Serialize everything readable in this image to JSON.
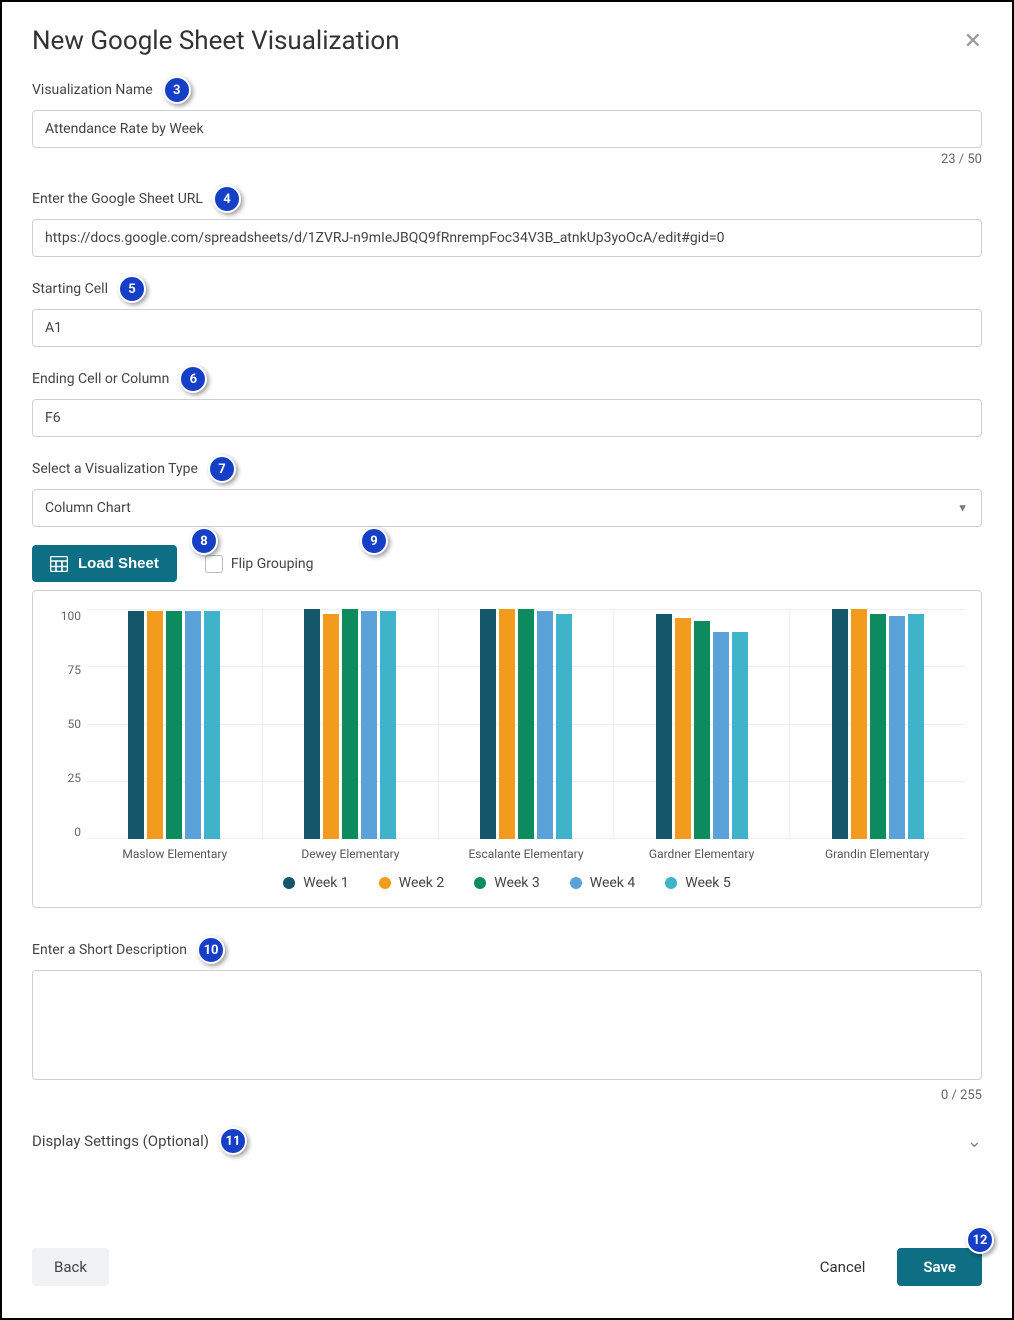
{
  "title": "New Google Sheet Visualization",
  "badges": {
    "name": "3",
    "url": "4",
    "start": "5",
    "end": "6",
    "viz": "7",
    "load": "8",
    "flip": "9",
    "desc": "10",
    "display": "11",
    "save": "12"
  },
  "fields": {
    "name_label": "Visualization Name",
    "name_value": "Attendance Rate by Week",
    "name_count": "23 / 50",
    "url_label": "Enter the Google Sheet URL",
    "url_value": "https://docs.google.com/spreadsheets/d/1ZVRJ-n9mIeJBQQ9fRnrempFoc34V3B_atnkUp3yoOcA/edit#gid=0",
    "start_label": "Starting Cell",
    "start_value": "A1",
    "end_label": "Ending Cell or Column",
    "end_value": "F6",
    "viz_label": "Select a Visualization Type",
    "viz_value": "Column Chart",
    "load_label": "Load Sheet",
    "flip_label": "Flip Grouping",
    "desc_label": "Enter a Short Description",
    "desc_value": "",
    "desc_count": "0 / 255",
    "display_label": "Display Settings (Optional)"
  },
  "buttons": {
    "back": "Back",
    "cancel": "Cancel",
    "save": "Save"
  },
  "chart_data": {
    "type": "bar",
    "categories": [
      "Maslow Elementary",
      "Dewey Elementary",
      "Escalante Elementary",
      "Gardner Elementary",
      "Grandin Elementary"
    ],
    "series": [
      {
        "name": "Week 1",
        "color": "#14566a",
        "values": [
          99,
          100,
          100,
          98,
          100
        ]
      },
      {
        "name": "Week 2",
        "color": "#f39b1c",
        "values": [
          99,
          98,
          100,
          96,
          100
        ]
      },
      {
        "name": "Week 3",
        "color": "#0d8a5e",
        "values": [
          99,
          101,
          101,
          95,
          98
        ]
      },
      {
        "name": "Week 4",
        "color": "#5aa2d8",
        "values": [
          99,
          99,
          99,
          90,
          97
        ]
      },
      {
        "name": "Week 5",
        "color": "#3fb3c9",
        "values": [
          99,
          99,
          98,
          90,
          98
        ]
      }
    ],
    "y_ticks": [
      100,
      75,
      50,
      25,
      0
    ],
    "ylim": [
      0,
      100
    ]
  }
}
